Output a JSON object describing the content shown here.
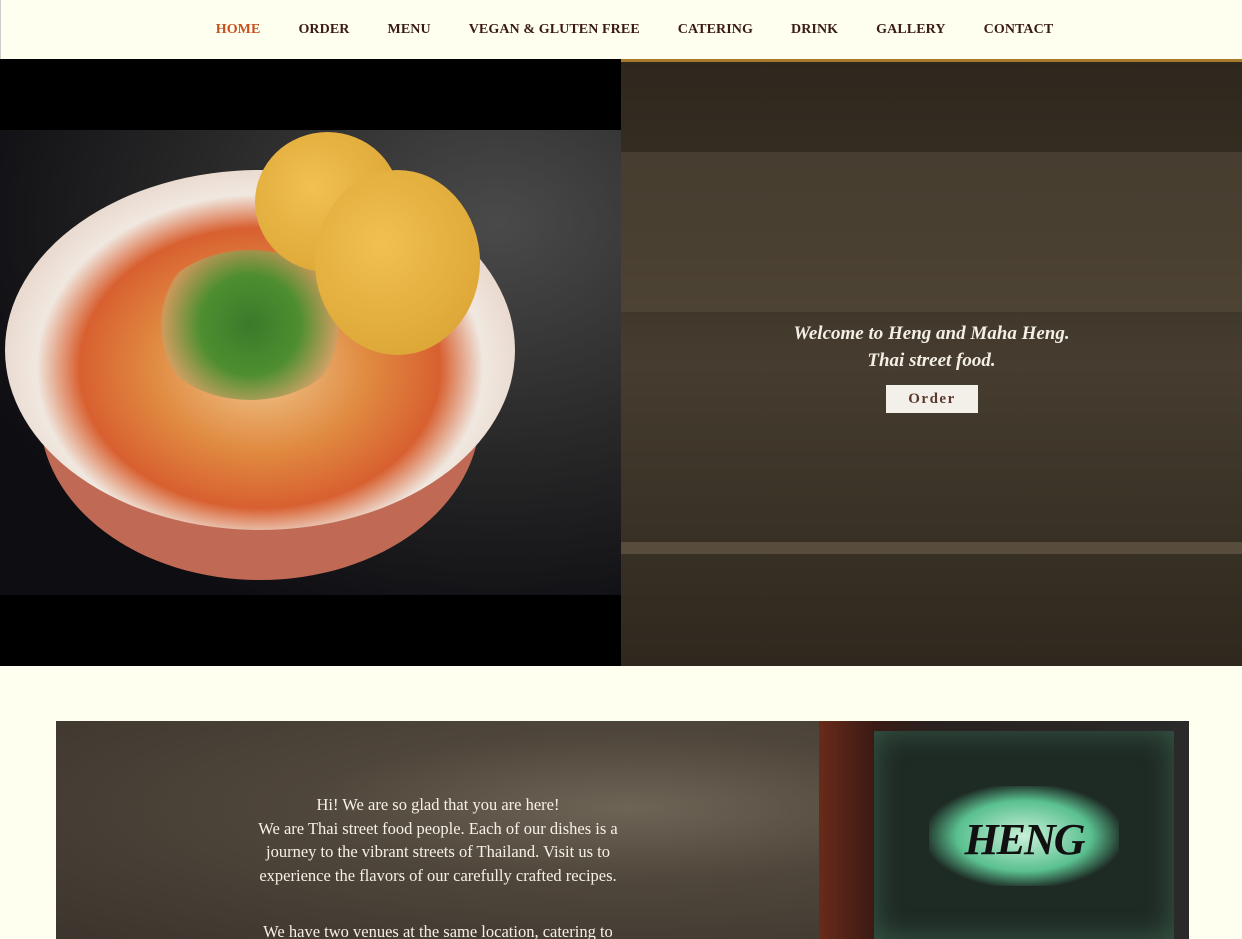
{
  "nav": {
    "items": [
      {
        "label": "HOME",
        "active": true
      },
      {
        "label": "ORDER"
      },
      {
        "label": "MENU"
      },
      {
        "label": "VEGAN & GLUTEN FREE"
      },
      {
        "label": "CATERING"
      },
      {
        "label": "DRINK"
      },
      {
        "label": "GALLERY"
      },
      {
        "label": "CONTACT"
      }
    ],
    "active_color": "#c8501c",
    "color": "#3a1a14"
  },
  "hero": {
    "line1": "Welcome to Heng and Maha Heng.",
    "line2": "Thai street food.",
    "order_label": "Order"
  },
  "intro": {
    "greeting": "Hi! We are so glad that you are here!",
    "paragraph1": "We are Thai street food people. Each of our dishes is a journey to the vibrant streets of Thailand. Visit us to experience the flavors of our carefully crafted recipes.",
    "paragraph2": "We have two venues at the same location, catering to"
  },
  "sign": {
    "logo_text": "HENG"
  },
  "background_color": "#fffff0"
}
